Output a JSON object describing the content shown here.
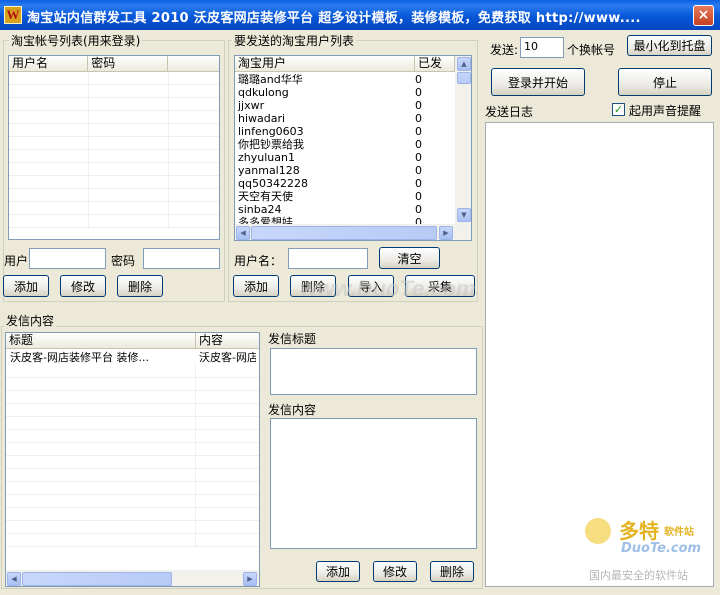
{
  "window": {
    "icon_letter": "W",
    "title": "淘宝站内信群发工具 2010  沃皮客网店装修平台  超多设计模板，装修模板，免费获取 http://www....",
    "close_glyph": "×"
  },
  "accounts": {
    "group_label": "淘宝帐号列表(用来登录)",
    "columns": [
      "用户名",
      "密码"
    ],
    "user_label": "用户",
    "password_label": "密码",
    "user_value": "",
    "password_value": "",
    "add_label": "添加",
    "edit_label": "修改",
    "delete_label": "删除"
  },
  "targets": {
    "group_label": "要发送的淘宝用户列表",
    "columns": [
      "淘宝用户",
      "已发"
    ],
    "rows": [
      {
        "user": "璐璐and华华",
        "sent": "0"
      },
      {
        "user": "qdkulong",
        "sent": "0"
      },
      {
        "user": "jjxwr",
        "sent": "0"
      },
      {
        "user": "hiwadari",
        "sent": "0"
      },
      {
        "user": "linfeng0603",
        "sent": "0"
      },
      {
        "user": "你把钞票给我",
        "sent": "0"
      },
      {
        "user": "zhyuluan1",
        "sent": "0"
      },
      {
        "user": "yanmal128",
        "sent": "0"
      },
      {
        "user": "qq50342228",
        "sent": "0"
      },
      {
        "user": "天空有天使",
        "sent": "0"
      },
      {
        "user": "sinba24",
        "sent": "0"
      },
      {
        "user": "多多爱想娃",
        "sent": "0"
      }
    ],
    "username_label": "用户名：",
    "username_value": "",
    "clear_label": "清空",
    "add_label": "添加",
    "delete_label": "删除",
    "import_label": "导入",
    "collect_label": "采集"
  },
  "controls": {
    "send_label": "发送:",
    "send_count": "10",
    "switch_label": "个换帐号",
    "minimize_label": "最小化到托盘",
    "login_start_label": "登录并开始",
    "stop_label": "停止",
    "log_label": "发送日志",
    "sound_label": "起用声音提醒",
    "sound_checked": "✓"
  },
  "messages": {
    "group_label": "发信内容",
    "columns": [
      "标题",
      "内容"
    ],
    "rows": [
      {
        "title": "沃皮客-网店装修平台  装修...",
        "content": "沃皮客-网店"
      }
    ],
    "subject_label": "发信标题",
    "subject_value": "",
    "body_label": "发信内容",
    "body_value": "",
    "add_label": "添加",
    "edit_label": "修改",
    "delete_label": "删除"
  },
  "watermarks": {
    "center_text": "www.DuoTe.com",
    "logo_cn": "多特",
    "logo_cn_small": "软件站",
    "logo_en": "DuoTe.com",
    "logo_slogan": "国内最安全的软件站"
  },
  "colors": {
    "titlebar": "#0757d7",
    "window_bg": "#ece9d8",
    "button_border": "#003c74",
    "logo": "#e3b321"
  }
}
